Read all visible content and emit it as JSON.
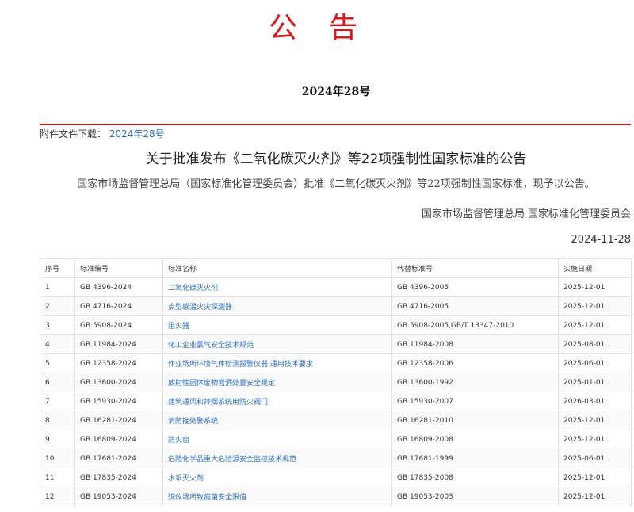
{
  "header": {
    "notice_title": "公告",
    "notice_number": "2024年28号"
  },
  "attachment": {
    "label": "附件文件下载：",
    "link_text": "2024年28号"
  },
  "article": {
    "heading": "关于批准发布《二氧化碳灭火剂》等22项强制性国家标准的公告",
    "paragraph": "国家市场监督管理总局（国家标准化管理委员会）批准《二氧化碳灭火剂》等22项强制性国家标准，现予以公告。",
    "issuer": "国家市场监督管理总局 国家标准化管理委员会",
    "date": "2024-11-28"
  },
  "table": {
    "headers": [
      "序号",
      "标准编号",
      "标准名称",
      "代替标准号",
      "实施日期"
    ],
    "rows": [
      [
        "1",
        "GB 4396-2024",
        "二氧化碳灭火剂",
        "GB 4396-2005",
        "2025-12-01"
      ],
      [
        "2",
        "GB 4716-2024",
        "点型感温火灾探测器",
        "GB 4716-2005",
        "2025-12-01"
      ],
      [
        "3",
        "GB 5908-2024",
        "阻火器",
        "GB 5908-2005,GB/T 13347-2010",
        "2025-12-01"
      ],
      [
        "4",
        "GB 11984-2024",
        "化工企业氯气安全技术规范",
        "GB 11984-2008",
        "2025-08-01"
      ],
      [
        "5",
        "GB 12358-2024",
        "作业场所环境气体检测报警仪器 通用技术要求",
        "GB 12358-2006",
        "2025-06-01"
      ],
      [
        "6",
        "GB 13600-2024",
        "放射性固体废物岩洞处置安全规定",
        "GB 13600-1992",
        "2025-01-01"
      ],
      [
        "7",
        "GB 15930-2024",
        "建筑通风和排烟系统用防火阀门",
        "GB 15930-2007",
        "2026-03-01"
      ],
      [
        "8",
        "GB 16281-2024",
        "消防接处警系统",
        "GB 16281-2010",
        "2025-12-01"
      ],
      [
        "9",
        "GB 16809-2024",
        "防火窗",
        "GB 16809-2008",
        "2025-12-01"
      ],
      [
        "10",
        "GB 17681-2024",
        "危险化学品重大危险源安全监控技术规范",
        "GB 17681-1999",
        "2025-06-01"
      ],
      [
        "11",
        "GB 17835-2024",
        "水系灭火剂",
        "GB 17835-2008",
        "2025-12-01"
      ],
      [
        "12",
        "GB 19053-2024",
        "殡仪场所致病菌安全限值",
        "GB 19053-2003",
        "2025-12-01"
      ]
    ]
  }
}
